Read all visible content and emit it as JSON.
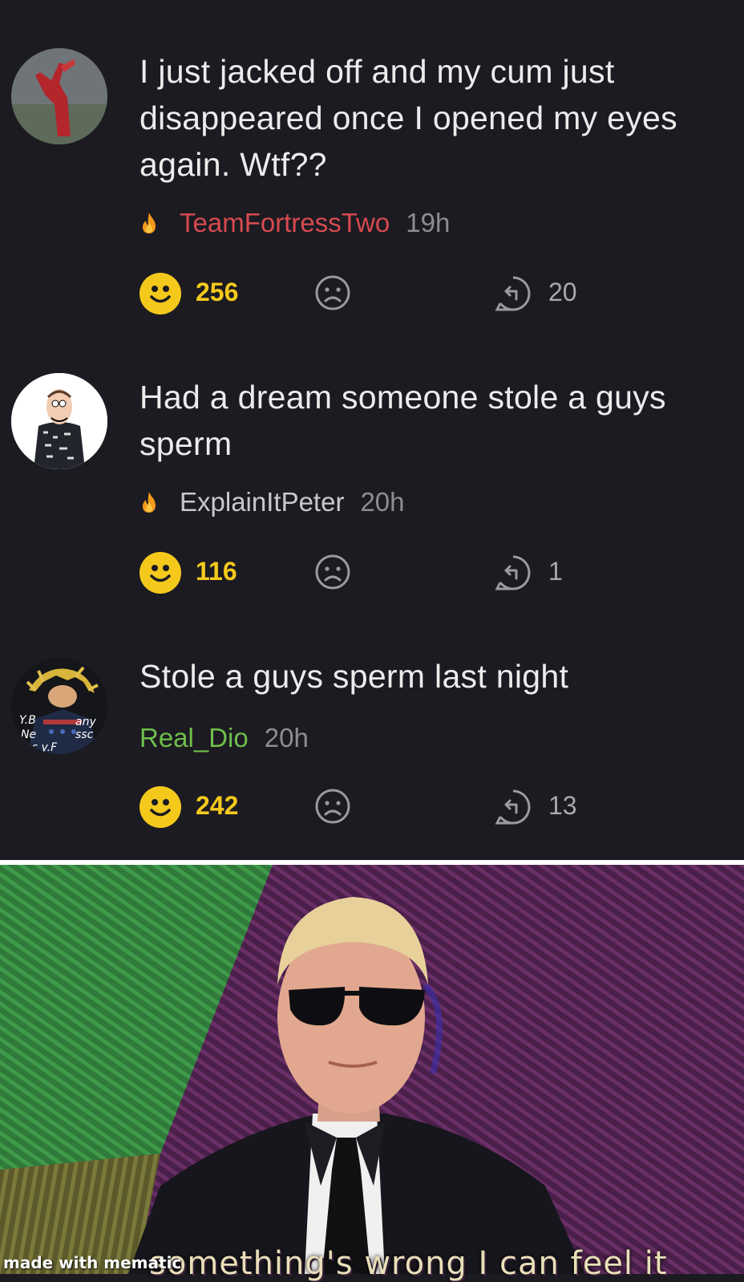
{
  "posts": [
    {
      "text": "I just jacked off and my cum just disappeared once I opened my eyes again. Wtf??",
      "username": "TeamFortressTwo",
      "username_color": "#d64a4f",
      "time": "19h",
      "likes": "256",
      "replies": "20",
      "flair_icon": "flame-icon",
      "avatar_icon": "red-figure-avatar"
    },
    {
      "text": "Had a dream someone stole a guys sperm",
      "username": "ExplainItPeter",
      "username_color": "#c9c9cd",
      "time": "20h",
      "likes": "116",
      "replies": "1",
      "flair_icon": "flame-icon",
      "avatar_icon": "peter-griffin-avatar"
    },
    {
      "text": "Stole a guys sperm last night",
      "username": "Real_Dio",
      "username_color": "#6fbf4c",
      "time": "20h",
      "likes": "242",
      "replies": "13",
      "avatar_icon": "dio-avatar"
    }
  ],
  "meme": {
    "caption": "something's wrong I can feel it",
    "watermark": "made with mematic"
  },
  "colors": {
    "background": "#1c1b21",
    "like_yellow": "#f4c91c",
    "muted_gray": "#8d8d93"
  }
}
